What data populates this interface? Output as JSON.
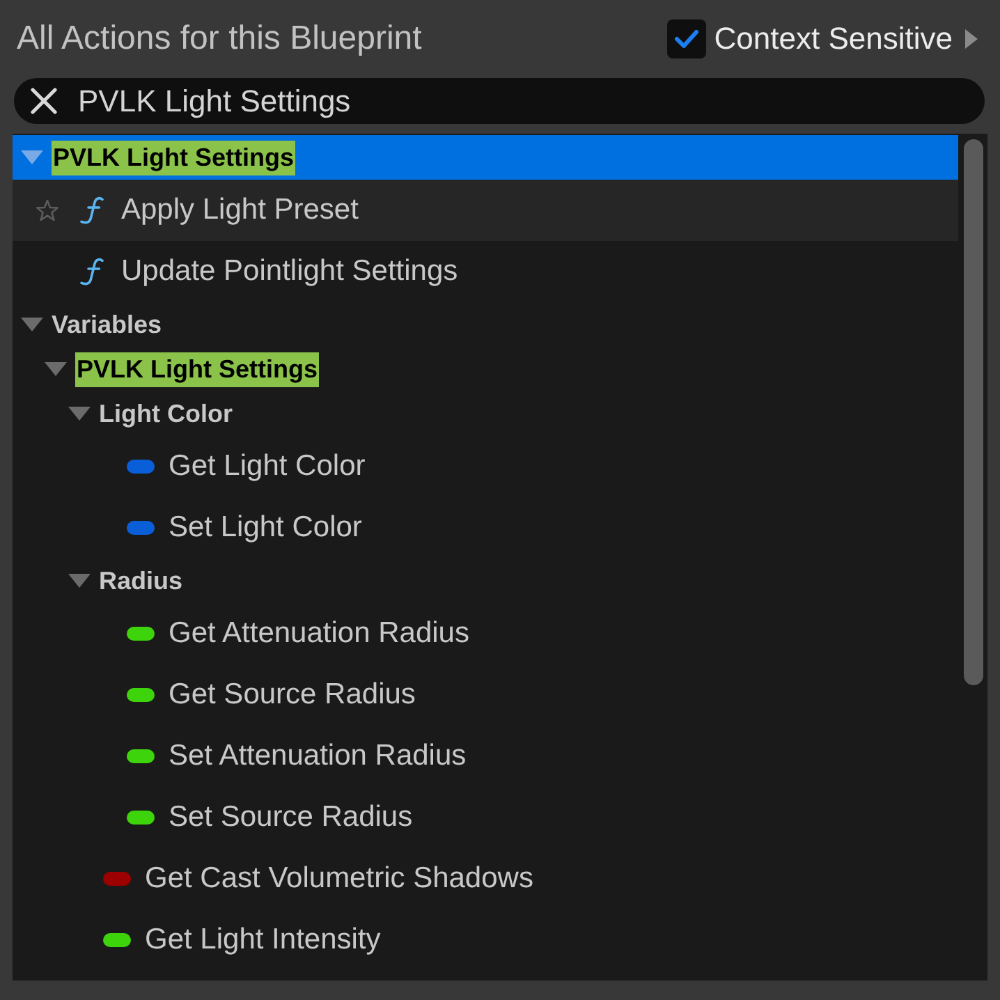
{
  "header": {
    "title": "All Actions for this Blueprint",
    "context_sensitive": {
      "label": "Context Sensitive",
      "checked": true
    }
  },
  "search": {
    "value": "PVLK Light Settings"
  },
  "tree": [
    {
      "kind": "category",
      "label": "PVLK Light Settings",
      "highlighted": true,
      "expanded": true,
      "selected": true,
      "children": [
        {
          "kind": "function",
          "label": "Apply Light Preset",
          "selected": false,
          "hovered": true
        },
        {
          "kind": "function",
          "label": "Update Pointlight Settings",
          "selected": false,
          "hovered": false
        }
      ]
    },
    {
      "kind": "category",
      "label": "Variables",
      "highlighted": false,
      "expanded": true,
      "selected": false,
      "children": [
        {
          "kind": "category",
          "label": "PVLK Light Settings",
          "highlighted": true,
          "expanded": true,
          "selected": false,
          "children": [
            {
              "kind": "category",
              "label": "Light Color",
              "highlighted": false,
              "expanded": true,
              "selected": false,
              "children": [
                {
                  "kind": "variable",
                  "label": "Get Light Color",
                  "color": "#0a5ed8",
                  "selected": false,
                  "hovered": false
                },
                {
                  "kind": "variable",
                  "label": "Set Light Color",
                  "color": "#0a5ed8",
                  "selected": false,
                  "hovered": false
                }
              ]
            },
            {
              "kind": "category",
              "label": "Radius",
              "highlighted": false,
              "expanded": true,
              "selected": false,
              "children": [
                {
                  "kind": "variable",
                  "label": "Get Attenuation Radius",
                  "color": "#3dd40b",
                  "selected": false,
                  "hovered": false
                },
                {
                  "kind": "variable",
                  "label": "Get Source Radius",
                  "color": "#3dd40b",
                  "selected": false,
                  "hovered": false
                },
                {
                  "kind": "variable",
                  "label": "Set Attenuation Radius",
                  "color": "#3dd40b",
                  "selected": false,
                  "hovered": false
                },
                {
                  "kind": "variable",
                  "label": "Set Source Radius",
                  "color": "#3dd40b",
                  "selected": false,
                  "hovered": false
                }
              ]
            },
            {
              "kind": "variable",
              "label": "Get Cast Volumetric Shadows",
              "color": "#9c0000",
              "selected": false,
              "hovered": false
            },
            {
              "kind": "variable",
              "label": "Get Light Intensity",
              "color": "#3dd40b",
              "selected": false,
              "hovered": false
            }
          ]
        }
      ]
    }
  ]
}
